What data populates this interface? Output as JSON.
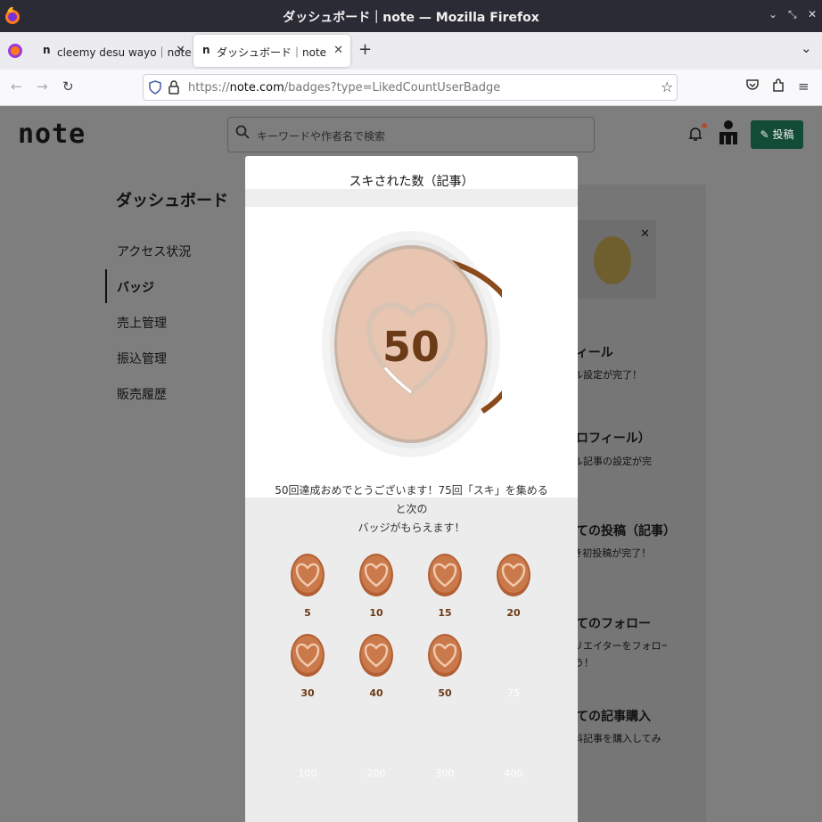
{
  "window": {
    "title": "ダッシュボード｜note — Mozilla Firefox",
    "controls": [
      "⌄",
      "⤡",
      "✕"
    ]
  },
  "tabs": [
    {
      "label": "cleemy desu wayo｜note",
      "favicon": "n",
      "active": false
    },
    {
      "label": "ダッシュボード｜note",
      "favicon": "n",
      "active": true
    }
  ],
  "newtab": "+",
  "tabmenu": "⌄",
  "navbar": {
    "url_prefix": "https://",
    "url_domain": "note.com",
    "url_path": "/badges?type=LikedCountUserBadge"
  },
  "site": {
    "logo": "note",
    "search_placeholder": "キーワードや作者名で検索",
    "post_button": "投稿"
  },
  "sidebar": {
    "title": "ダッシュボード",
    "items": [
      {
        "label": "アクセス状況"
      },
      {
        "label": "バッジ",
        "active": true
      },
      {
        "label": "売上管理"
      },
      {
        "label": "振込管理"
      },
      {
        "label": "販売履歴"
      }
    ]
  },
  "right_panel": {
    "items": [
      {
        "title": "フィール",
        "sub": "ール設定が完了！",
        "sub2": ""
      },
      {
        "title": "プロフィール）",
        "sub": "ール記事の設定が完",
        "sub2": ""
      },
      {
        "title": "めての投稿（記事）",
        "sub": "念すべき初投稿が完了！",
        "sub2": ""
      },
      {
        "title": "めてのフォロー",
        "sub": "きなクリエイターをフォロー",
        "sub2": "しょう！"
      },
      {
        "title": "めての記事購入",
        "sub": "めて有料記事を購入してみ",
        "sub2": "！"
      }
    ]
  },
  "modal": {
    "title": "スキされた数（記事）",
    "current_badge": "50",
    "progress_fraction": 0.38,
    "message_line1": "50回達成おめでとうございます！75回「スキ」を集めると次の",
    "message_line2": "バッジがもらえます！",
    "badges": [
      {
        "count": "5",
        "earned": true
      },
      {
        "count": "10",
        "earned": true
      },
      {
        "count": "15",
        "earned": true
      },
      {
        "count": "20",
        "earned": true
      },
      {
        "count": "30",
        "earned": true
      },
      {
        "count": "40",
        "earned": true
      },
      {
        "count": "50",
        "earned": true
      },
      {
        "count": "75",
        "earned": false
      },
      {
        "count": "100",
        "earned": false
      },
      {
        "count": "200",
        "earned": false
      },
      {
        "count": "300",
        "earned": false
      },
      {
        "count": "400",
        "earned": false
      }
    ]
  },
  "colors": {
    "accent_green": "#124b36",
    "progress_brown": "#8b4a1c",
    "badge_copper": "#c9794a",
    "badge_text": "#6b3a16"
  }
}
